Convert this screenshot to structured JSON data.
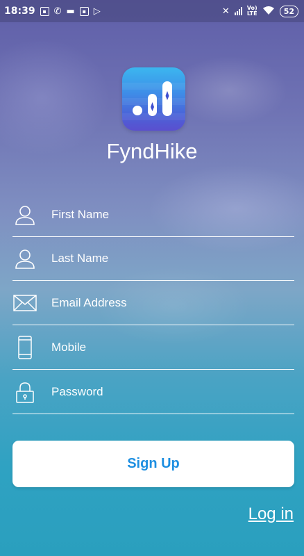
{
  "status_bar": {
    "time": "18:39",
    "battery": "52",
    "network_label_top": "Vo)",
    "network_label_bottom": "LTE"
  },
  "app": {
    "name": "FyndHike",
    "logo_icon": "chart-bars-icon"
  },
  "form": {
    "fields": [
      {
        "placeholder": "First Name",
        "icon": "person-icon"
      },
      {
        "placeholder": "Last Name",
        "icon": "person-icon"
      },
      {
        "placeholder": "Email Address",
        "icon": "envelope-icon"
      },
      {
        "placeholder": "Mobile",
        "icon": "phone-icon"
      },
      {
        "placeholder": "Password",
        "icon": "lock-icon"
      }
    ],
    "signup_label": "Sign Up",
    "login_label": "Log in"
  },
  "colors": {
    "accent": "#1e8fe1",
    "logo_top": "#3bb6ef",
    "logo_bottom": "#5a4fcf"
  }
}
